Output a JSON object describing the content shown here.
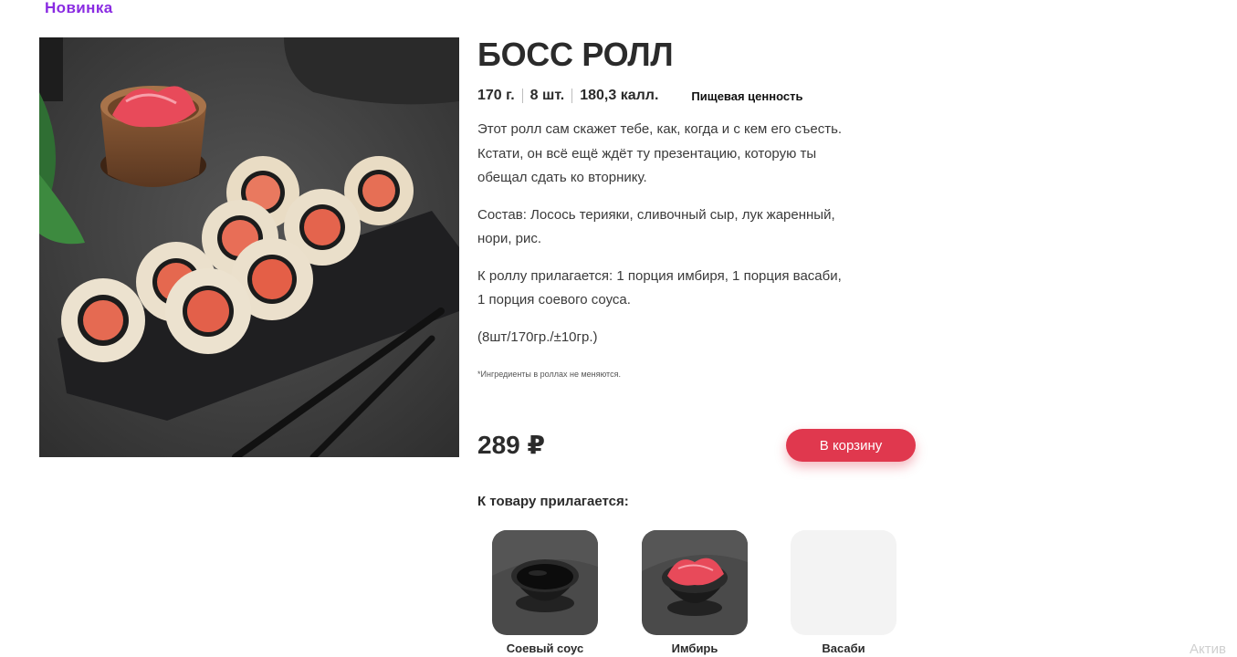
{
  "badge": {
    "label": "Новинка"
  },
  "product": {
    "name": "БОСС РОЛЛ",
    "specs": {
      "weight": "170  г.",
      "pieces": "8  шт.",
      "calories": "180,3 калл."
    },
    "nutrition_link": "Пищевая ценность",
    "description": [
      "Этот ролл сам скажет тебе, как, когда и с кем его съесть. Кстати, он всё ещё ждёт ту презентацию, которую ты обещал сдать ко вторнику.",
      "Состав: Лосось терияки, сливочный сыр, лук жаренный, нори, рис.",
      "К роллу прилагается: 1 порция имбиря, 1 порция васаби, 1 порция соевого соуса.",
      "(8шт/170гр./±10гр.)"
    ],
    "note": "*Ингредиенты в роллах не меняются.",
    "price": "289  ₽",
    "add_to_cart": "В корзину"
  },
  "addons": {
    "title": "К товару прилагается:",
    "items": [
      {
        "label": "Соевый соус",
        "icon": "soy-sauce-bowl-image"
      },
      {
        "label": "Имбирь",
        "icon": "ginger-bowl-image"
      },
      {
        "label": "Васаби",
        "icon": "wasabi-placeholder"
      }
    ]
  },
  "watermark": "Актив",
  "colors": {
    "accent_purple": "#8a2be2",
    "button_red": "#e0384e",
    "text": "#2b2b2b"
  }
}
